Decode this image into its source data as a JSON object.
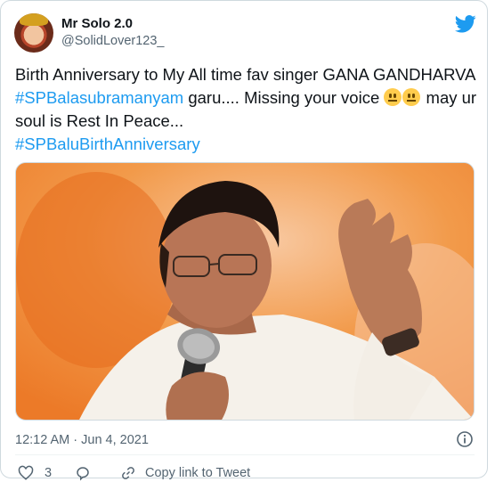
{
  "tweet": {
    "author_name": "Mr Solo 2.0",
    "author_handle": "@SolidLover123_",
    "text_line1_a": "Birth Anniversary to  My All time fav singer GANA GANDHARVA ",
    "hashtag1": "#SPBalasubramanyam",
    "text_line2_a": "  garu.... Missing your voice ",
    "text_line3_a": " may ur soul is Rest In Peace...",
    "hashtag2": "#SPBaluBirthAnniversary",
    "emoji_name": "neutral-face",
    "timestamp": "12:12 AM · Jun 4, 2021"
  },
  "actions": {
    "like_count": "3",
    "copy_link_label": "Copy link to Tweet"
  },
  "icons": {
    "brand": "twitter-bird-icon",
    "info": "info-icon",
    "like": "heart-icon",
    "reply": "reply-bubble-icon",
    "copy": "link-icon"
  },
  "colors": {
    "accent": "#1d9bf0",
    "text": "#0f1419",
    "muted": "#536471",
    "border": "#cfd9de"
  }
}
